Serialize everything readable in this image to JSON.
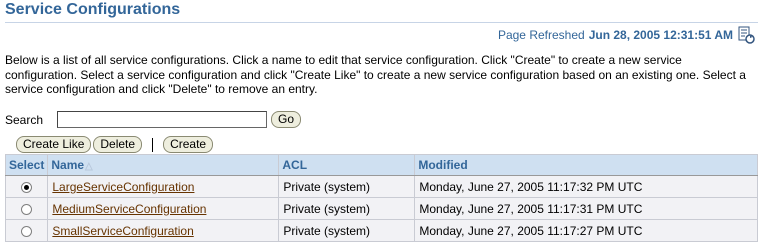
{
  "page": {
    "title": "Service Configurations",
    "refreshed_label": "Page Refreshed",
    "refreshed_time": "Jun 28, 2005 12:31:51 AM",
    "intro": "Below is a list of all service configurations. Click a name to edit that service configuration. Click \"Create\" to create a new service configuration. Select a service configuration and click \"Create Like\" to create a new service configuration based on an existing one. Select a service configuration and click \"Delete\" to remove an entry."
  },
  "search": {
    "label": "Search",
    "value": "",
    "go_label": "Go"
  },
  "actions": {
    "create_like": "Create Like",
    "delete": "Delete",
    "create": "Create"
  },
  "table": {
    "headers": {
      "select": "Select",
      "name": "Name",
      "acl": "ACL",
      "modified": "Modified"
    },
    "rows": [
      {
        "selected": true,
        "name": "LargeServiceConfiguration",
        "acl": "Private (system)",
        "modified": "Monday, June 27, 2005 11:17:32 PM UTC"
      },
      {
        "selected": false,
        "name": "MediumServiceConfiguration",
        "acl": "Private (system)",
        "modified": "Monday, June 27, 2005 11:17:31 PM UTC"
      },
      {
        "selected": false,
        "name": "SmallServiceConfiguration",
        "acl": "Private (system)",
        "modified": "Monday, June 27, 2005 11:17:27 PM UTC"
      }
    ]
  },
  "colors": {
    "header_text": "#336699",
    "header_bg": "#cfe0f1",
    "link": "#663300"
  },
  "icons": {
    "refresh": "refresh-icon",
    "sort": "sort-ascending-icon"
  }
}
